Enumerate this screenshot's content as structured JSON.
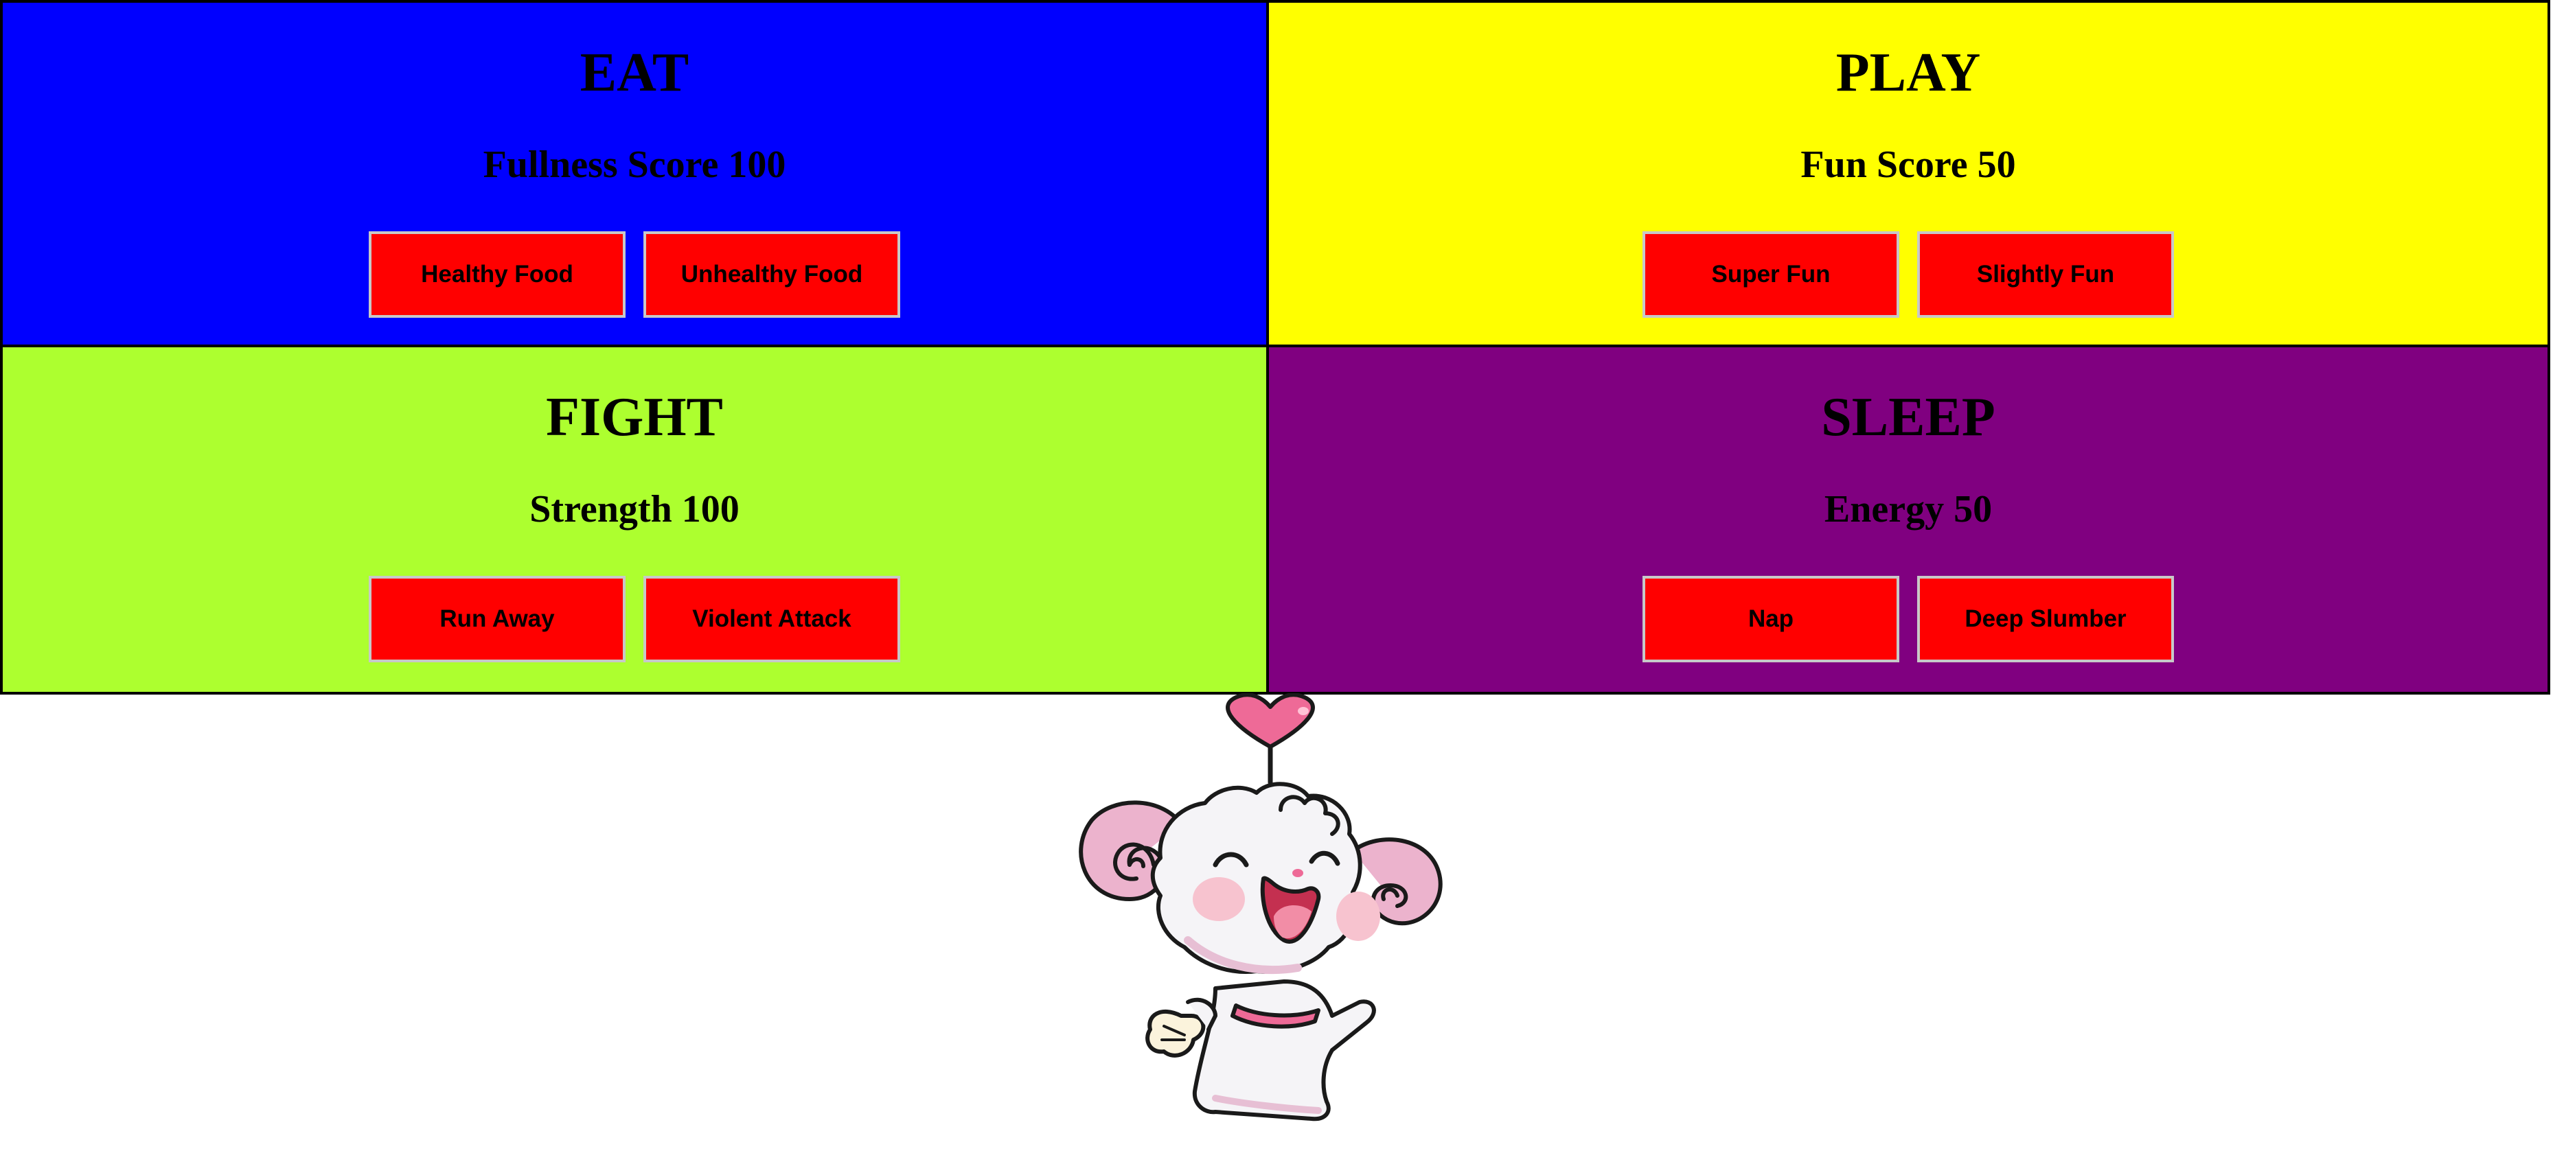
{
  "panels": {
    "eat": {
      "title": "EAT",
      "score_text": "Fullness Score 100",
      "buttons": [
        "Healthy Food",
        "Unhealthy Food"
      ],
      "color": "#0000ff"
    },
    "play": {
      "title": "PLAY",
      "score_text": "Fun Score 50",
      "buttons": [
        "Super Fun",
        "Slightly Fun"
      ],
      "color": "#ffff00"
    },
    "fight": {
      "title": "FIGHT",
      "score_text": "Strength 100",
      "buttons": [
        "Run Away",
        "Violent Attack"
      ],
      "color": "#adff2f"
    },
    "sleep": {
      "title": "SLEEP",
      "score_text": "Energy 50",
      "buttons": [
        "Nap",
        "Deep Slumber"
      ],
      "color": "#800080"
    }
  },
  "button_color": "#ff0000",
  "pet": {
    "image": "pink-horned-sheep-mascot"
  }
}
